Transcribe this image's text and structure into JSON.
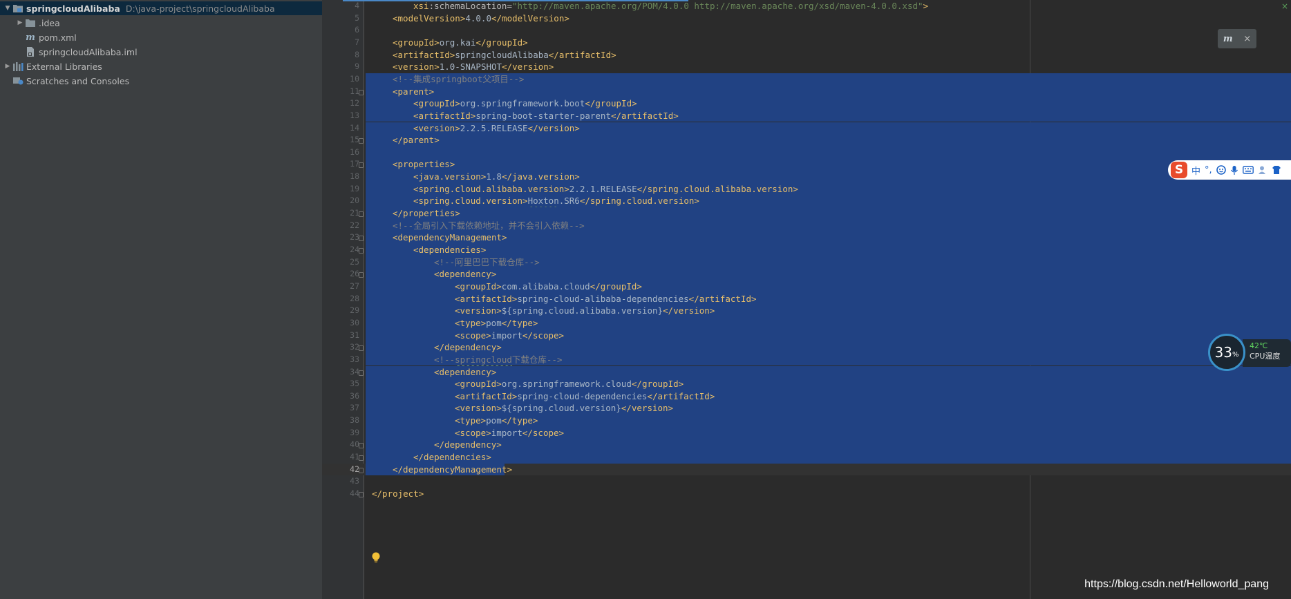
{
  "project_tree": [
    {
      "name": "springcloudAlibaba",
      "path": "D:\\java-project\\springcloudAlibaba",
      "icon": "module-folder-icon",
      "arrow": "expanded",
      "indent": 0,
      "selected": true
    },
    {
      "name": ".idea",
      "icon": "folder-icon",
      "arrow": "collapsed",
      "indent": 1
    },
    {
      "name": "pom.xml",
      "icon": "maven-file-icon",
      "arrow": "none",
      "indent": 1
    },
    {
      "name": "springcloudAlibaba.iml",
      "icon": "iml-file-icon",
      "arrow": "none",
      "indent": 1
    },
    {
      "name": "External Libraries",
      "icon": "libraries-icon",
      "arrow": "collapsed",
      "indent": 0
    },
    {
      "name": "Scratches and Consoles",
      "icon": "scratches-icon",
      "arrow": "none",
      "indent": 0
    }
  ],
  "editor": {
    "current_line": 42,
    "lines": [
      {
        "n": 4,
        "indent": 4,
        "raw": "xsi:schemaLocation=\"http://maven.apache.org/POM/4.0.0 http://maven.apache.org/xsd/maven-4.0.0.xsd\">"
      },
      {
        "n": 5,
        "indent": 2,
        "raw": "<modelVersion>4.0.0</modelVersion>"
      },
      {
        "n": 6,
        "indent": 0,
        "raw": ""
      },
      {
        "n": 7,
        "indent": 2,
        "raw": "<groupId>org.kai</groupId>"
      },
      {
        "n": 8,
        "indent": 2,
        "raw": "<artifactId>springcloudAlibaba</artifactId>"
      },
      {
        "n": 9,
        "indent": 2,
        "raw": "<version>1.0-SNAPSHOT</version>"
      },
      {
        "n": 10,
        "indent": 2,
        "raw": "<!--集成springboot父项目-->",
        "sel": true
      },
      {
        "n": 11,
        "indent": 2,
        "raw": "<parent>",
        "sel": true,
        "fold": true
      },
      {
        "n": 12,
        "indent": 4,
        "raw": "<groupId>org.springframework.boot</groupId>",
        "sel": true
      },
      {
        "n": 13,
        "indent": 4,
        "raw": "<artifactId>spring-boot-starter-parent</artifactId>",
        "sel": true
      },
      {
        "n": 14,
        "indent": 4,
        "raw": "<version>2.2.5.RELEASE</version>",
        "sel": true
      },
      {
        "n": 15,
        "indent": 2,
        "raw": "</parent>",
        "sel": true,
        "fold": true
      },
      {
        "n": 16,
        "indent": 0,
        "raw": "",
        "sel": true
      },
      {
        "n": 17,
        "indent": 2,
        "raw": "<properties>",
        "sel": true,
        "fold": true
      },
      {
        "n": 18,
        "indent": 4,
        "raw": "<java.version>1.8</java.version>",
        "sel": true
      },
      {
        "n": 19,
        "indent": 4,
        "raw": "<spring.cloud.alibaba.version>2.2.1.RELEASE</spring.cloud.alibaba.version>",
        "sel": true
      },
      {
        "n": 20,
        "indent": 4,
        "raw": "<spring.cloud.version>Hoxton.SR6</spring.cloud.version>",
        "sel": true,
        "typo": "Hoxton"
      },
      {
        "n": 21,
        "indent": 2,
        "raw": "</properties>",
        "sel": true,
        "fold": true
      },
      {
        "n": 22,
        "indent": 2,
        "raw": "<!--全局引入下载依赖地址，并不会引入依赖-->",
        "sel": true
      },
      {
        "n": 23,
        "indent": 2,
        "raw": "<dependencyManagement>",
        "sel": true,
        "fold": true
      },
      {
        "n": 24,
        "indent": 4,
        "raw": "<dependencies>",
        "sel": true,
        "fold": true
      },
      {
        "n": 25,
        "indent": 6,
        "raw": "<!--阿里巴巴下载仓库-->",
        "sel": true
      },
      {
        "n": 26,
        "indent": 6,
        "raw": "<dependency>",
        "sel": true,
        "fold": true
      },
      {
        "n": 27,
        "indent": 8,
        "raw": "<groupId>com.alibaba.cloud</groupId>",
        "sel": true
      },
      {
        "n": 28,
        "indent": 8,
        "raw": "<artifactId>spring-cloud-alibaba-dependencies</artifactId>",
        "sel": true
      },
      {
        "n": 29,
        "indent": 8,
        "raw": "<version>${spring.cloud.alibaba.version}</version>",
        "sel": true
      },
      {
        "n": 30,
        "indent": 8,
        "raw": "<type>pom</type>",
        "sel": true
      },
      {
        "n": 31,
        "indent": 8,
        "raw": "<scope>import</scope>",
        "sel": true
      },
      {
        "n": 32,
        "indent": 6,
        "raw": "</dependency>",
        "sel": true,
        "fold": true
      },
      {
        "n": 33,
        "indent": 6,
        "raw": "<!--springcloud下载仓库-->",
        "sel": true,
        "typo": "springcloud"
      },
      {
        "n": 34,
        "indent": 6,
        "raw": "<dependency>",
        "sel": true,
        "fold": true
      },
      {
        "n": 35,
        "indent": 8,
        "raw": "<groupId>org.springframework.cloud</groupId>",
        "sel": true
      },
      {
        "n": 36,
        "indent": 8,
        "raw": "<artifactId>spring-cloud-dependencies</artifactId>",
        "sel": true
      },
      {
        "n": 37,
        "indent": 8,
        "raw": "<version>${spring.cloud.version}</version>",
        "sel": true
      },
      {
        "n": 38,
        "indent": 8,
        "raw": "<type>pom</type>",
        "sel": true
      },
      {
        "n": 39,
        "indent": 8,
        "raw": "<scope>import</scope>",
        "sel": true
      },
      {
        "n": 40,
        "indent": 6,
        "raw": "</dependency>",
        "sel": true,
        "fold": true
      },
      {
        "n": 41,
        "indent": 4,
        "raw": "</dependencies>",
        "sel": true,
        "fold": true
      },
      {
        "n": 42,
        "indent": 2,
        "raw": "</dependencyManagement>",
        "sel": true,
        "fold": true,
        "partial": true
      },
      {
        "n": 43,
        "indent": 0,
        "raw": ""
      },
      {
        "n": 44,
        "indent": 0,
        "raw": "</project>",
        "fold": true
      }
    ]
  },
  "overlays": {
    "maven_popup": {
      "icon": "maven-reload-icon",
      "glyph": "m",
      "close": "×"
    },
    "ime_toolbar": {
      "logo": "S",
      "mode": "中",
      "punct": "°,",
      "icons": [
        "emoji-icon",
        "microphone-icon",
        "keyboard-icon",
        "user-icon",
        "skin-icon"
      ]
    },
    "cpu_widget": {
      "percent": "33",
      "unit": "%",
      "temperature": "42℃",
      "label": "CPU温度"
    },
    "watermark": "https://blog.csdn.net/Helloworld_pang",
    "status_color": "#5fd35f"
  },
  "colors": {
    "selection": "#214283",
    "tag": "#e8bf6a",
    "comment": "#808080",
    "text": "#a9b7c6",
    "string": "#6a8759",
    "gutter": "#313335",
    "tree_bg": "#3c3f41"
  }
}
